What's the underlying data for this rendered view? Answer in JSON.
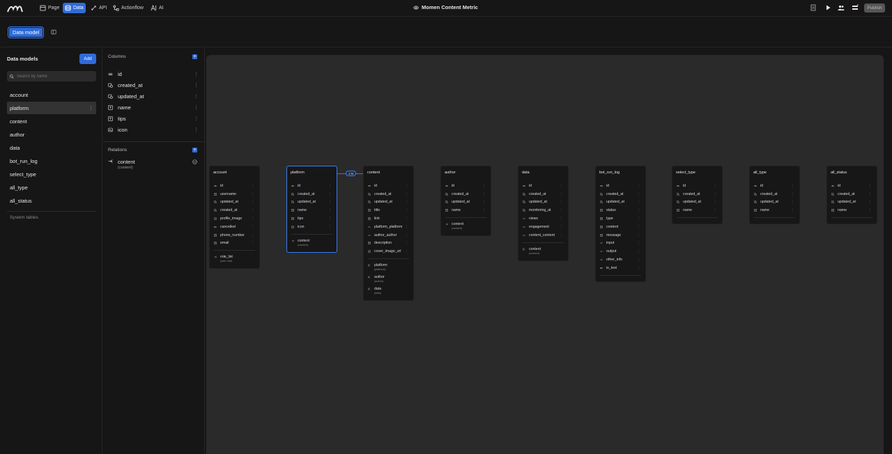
{
  "topbar": {
    "tabs": [
      {
        "label": "Page",
        "icon": "page-icon"
      },
      {
        "label": "Data",
        "icon": "data-icon",
        "active": true
      },
      {
        "label": "API",
        "icon": "api-icon"
      },
      {
        "label": "Actionflow",
        "icon": "actionflow-icon"
      },
      {
        "label": "AI",
        "icon": "ai-icon"
      }
    ],
    "project_title": "Momen Content Metric",
    "publish_label": "Publish",
    "accent": "#2f6bd9"
  },
  "subbar": {
    "data_model_label": "Data model"
  },
  "left": {
    "heading": "Data models",
    "add_label": "Add",
    "search_placeholder": "Search by name",
    "models": [
      "account",
      "platform",
      "content",
      "author",
      "data",
      "bot_run_log",
      "select_type",
      "all_type",
      "all_status"
    ],
    "selected": "platform",
    "system_tables_label": "System tables"
  },
  "mid": {
    "columns_heading": "Columns",
    "columns": [
      "id",
      "created_at",
      "updated_at",
      "name",
      "tips",
      "icon"
    ],
    "relations_heading": "Relations",
    "relation": {
      "name": "content",
      "target": "(content)"
    }
  },
  "canvas": {
    "relation_badge": "1:N",
    "tables": [
      {
        "name": "account",
        "columns": [
          "id",
          "username",
          "updated_at",
          "created_at",
          "profile_image",
          "cancelled",
          "phone_number",
          "email"
        ],
        "relations": [
          {
            "name": "role_list",
            "target": "(user role)"
          }
        ]
      },
      {
        "name": "platform",
        "columns": [
          "id",
          "created_at",
          "updated_at",
          "name",
          "tips",
          "icon"
        ],
        "relations": [
          {
            "name": "content",
            "target": "(content)"
          }
        ]
      },
      {
        "name": "content",
        "columns": [
          "id",
          "created_at",
          "updated_at",
          "title",
          "link",
          "platform_platform",
          "author_author",
          "description",
          "cover_image_url"
        ],
        "relations": [
          {
            "name": "platform",
            "target": "(platform)"
          },
          {
            "name": "author",
            "target": "(author)"
          },
          {
            "name": "data",
            "target": "(data)"
          }
        ]
      },
      {
        "name": "author",
        "columns": [
          "id",
          "created_at",
          "updated_at",
          "name"
        ],
        "relations": [
          {
            "name": "content",
            "target": "(content)"
          }
        ]
      },
      {
        "name": "data",
        "columns": [
          "id",
          "created_at",
          "updated_at",
          "monitoring_at",
          "views",
          "engagement",
          "content_content"
        ],
        "relations": [
          {
            "name": "content",
            "target": "(content)"
          }
        ]
      },
      {
        "name": "bot_run_log",
        "columns": [
          "id",
          "created_at",
          "updated_at",
          "status",
          "type",
          "content",
          "message",
          "input",
          "output",
          "other_info",
          "is_test"
        ],
        "relations": []
      },
      {
        "name": "select_type",
        "columns": [
          "id",
          "created_at",
          "updated_at",
          "name"
        ],
        "relations": []
      },
      {
        "name": "all_type",
        "columns": [
          "id",
          "created_at",
          "updated_at",
          "name"
        ],
        "relations": []
      },
      {
        "name": "all_status",
        "columns": [
          "id",
          "created_at",
          "updated_at",
          "name"
        ],
        "relations": []
      }
    ]
  }
}
